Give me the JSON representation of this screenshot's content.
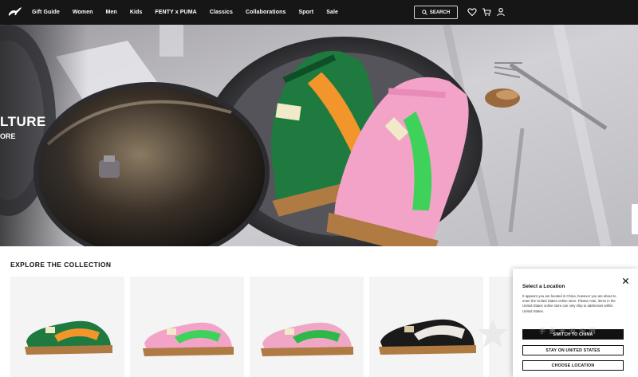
{
  "nav": {
    "links": [
      "Gift Guide",
      "Women",
      "Men",
      "Kids",
      "FENTY x PUMA",
      "Classics",
      "Collaborations",
      "Sport",
      "Sale"
    ],
    "search_label": "SEARCH"
  },
  "hero": {
    "headline": "LTURE",
    "subline": "ORE"
  },
  "collection": {
    "title": "EXPLORE THE COLLECTION"
  },
  "location_modal": {
    "title": "Select a Location",
    "body": "It appears you are located in China, however you are about to enter the United States online store. Please note, items in the United States online store can only ship to addresses within United States.",
    "switch_button": "SWITCH TO CHINA",
    "stay_button": "STAY ON UNITED STATES",
    "choose_button": "CHOOSE LOCATION"
  },
  "watermark_text": "手 更 米 游 淘 网",
  "colors": {
    "nav_bg": "#161616",
    "sneaker_green": "#1f7a3f",
    "sneaker_orange": "#f2952b",
    "sneaker_pink": "#f3a3c8",
    "sneaker_lime": "#3fd25a",
    "gum_sole": "#b07a43"
  },
  "icons": [
    "puma-logo-icon",
    "search-icon",
    "heart-icon",
    "cart-icon",
    "user-icon",
    "close-icon"
  ]
}
